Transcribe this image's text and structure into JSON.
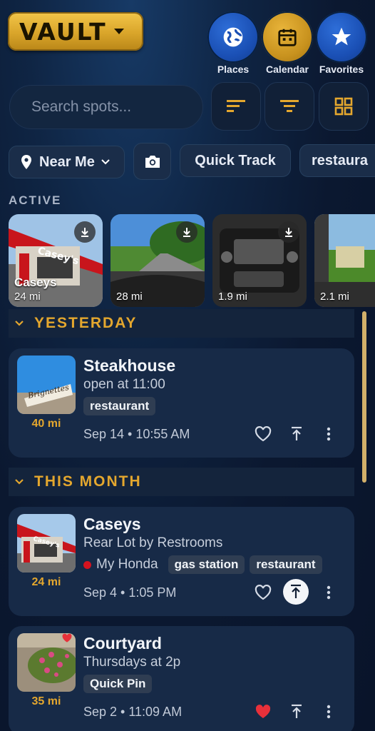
{
  "header": {
    "vault_label": "VAULT",
    "nav": [
      {
        "label": "Places",
        "icon": "globe-icon"
      },
      {
        "label": "Calendar",
        "icon": "calendar-icon"
      },
      {
        "label": "Favorites",
        "icon": "star-icon"
      }
    ]
  },
  "search": {
    "placeholder": "Search spots..."
  },
  "chips": {
    "near_me": "Near Me",
    "quick_track": "Quick Track",
    "restaurant": "restaura"
  },
  "active": {
    "label": "ACTIVE",
    "items": [
      {
        "name": "Caseys",
        "distance": "24 mi"
      },
      {
        "name": "",
        "distance": "28 mi"
      },
      {
        "name": "",
        "distance": "1.9 mi"
      },
      {
        "name": "",
        "distance": "2.1 mi"
      }
    ]
  },
  "groups": [
    {
      "title": "YESTERDAY",
      "cards": [
        {
          "title": "Steakhouse",
          "subtitle": "open at 11:00",
          "tags": [
            "restaurant"
          ],
          "distance": "40 mi",
          "date": "Sep 14 • 10:55 AM",
          "favorite": false,
          "image_sign": "Brignettes"
        }
      ]
    },
    {
      "title": "THIS MONTH",
      "cards": [
        {
          "title": "Caseys",
          "subtitle": "Rear Lot by Restrooms",
          "vehicle": "My Honda",
          "tags": [
            "gas station",
            "restaurant"
          ],
          "distance": "24 mi",
          "date": "Sep 4 • 1:05 PM",
          "favorite": false,
          "image_sign": "Casey's"
        },
        {
          "title": "Courtyard",
          "subtitle": "Thursdays at 2p",
          "tags": [
            "Quick Pin"
          ],
          "distance": "35 mi",
          "date": "Sep 2 • 11:09 AM",
          "favorite": true
        }
      ]
    }
  ],
  "colors": {
    "accent": "#e4a72e",
    "brand_blue": "#1a4fb4",
    "favorite_red": "#e8303a"
  }
}
